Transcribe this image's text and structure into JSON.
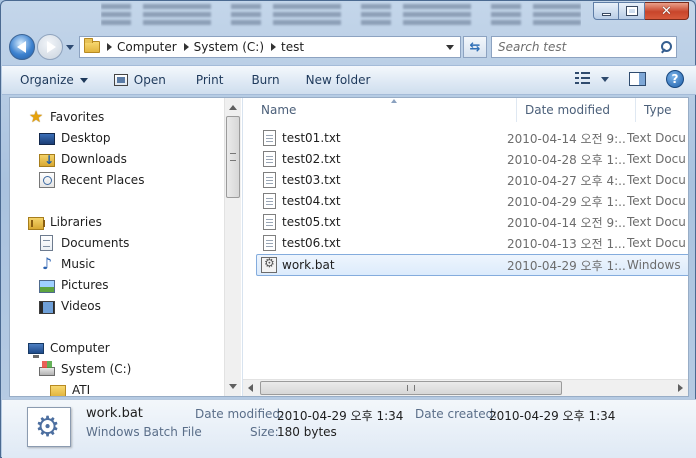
{
  "window": {
    "minimize": "Minimize",
    "maximize": "Maximize",
    "close": "Close"
  },
  "address": {
    "crumbs": [
      "Computer",
      "System (C:)",
      "test"
    ]
  },
  "search": {
    "placeholder": "Search test"
  },
  "toolbar": {
    "organize": "Organize",
    "open": "Open",
    "print": "Print",
    "burn": "Burn",
    "new_folder": "New folder",
    "help": "?"
  },
  "nav": {
    "favorites": "Favorites",
    "desktop": "Desktop",
    "downloads": "Downloads",
    "recent_places": "Recent Places",
    "libraries": "Libraries",
    "documents": "Documents",
    "music": "Music",
    "pictures": "Pictures",
    "videos": "Videos",
    "computer": "Computer",
    "system_c": "System (C:)",
    "ati": "ATI"
  },
  "columns": {
    "name": "Name",
    "date_modified": "Date modified",
    "type": "Type"
  },
  "files": [
    {
      "name": "test01.txt",
      "date": "2010-04-14 오전 9:...",
      "type": "Text Docu"
    },
    {
      "name": "test02.txt",
      "date": "2010-04-28 오후 1:...",
      "type": "Text Docu"
    },
    {
      "name": "test03.txt",
      "date": "2010-04-27 오후 4:...",
      "type": "Text Docu"
    },
    {
      "name": "test04.txt",
      "date": "2010-04-29 오후 1:...",
      "type": "Text Docu"
    },
    {
      "name": "test05.txt",
      "date": "2010-04-14 오전 9:...",
      "type": "Text Docu"
    },
    {
      "name": "test06.txt",
      "date": "2010-04-13 오전 1...",
      "type": "Text Docu"
    },
    {
      "name": "work.bat",
      "date": "2010-04-29 오후 1:...",
      "type": "Windows"
    }
  ],
  "details": {
    "file_name": "work.bat",
    "file_type": "Windows Batch File",
    "date_modified_label": "Date modified:",
    "date_modified": "2010-04-29 오후 1:34",
    "date_created_label": "Date created:",
    "date_created": "2010-04-29 오후 1:34",
    "size_label": "Size:",
    "size": "180 bytes"
  }
}
